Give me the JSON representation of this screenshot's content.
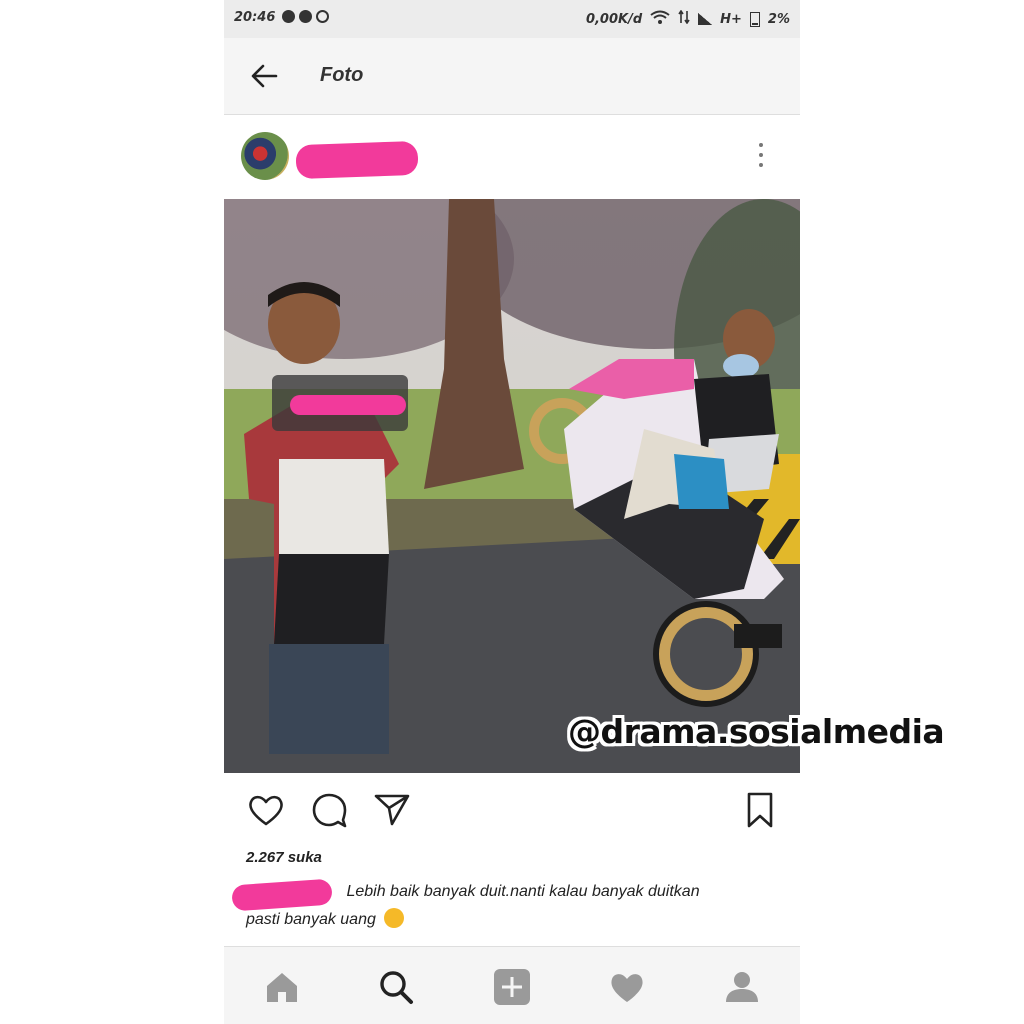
{
  "status_bar": {
    "time": "20:46",
    "speed": "0,00K/d",
    "network": "H+",
    "battery": "2%"
  },
  "header": {
    "title": "Foto"
  },
  "post": {
    "likes": "2.267 suka",
    "caption_line1": "Lebih baik banyak duit.nanti kalau banyak duitkan",
    "caption_line2": "pasti banyak uang"
  },
  "watermark": "@drama.sosialmedia",
  "colors": {
    "redaction": "#f23a9b",
    "status_bar_bg": "#ececec",
    "header_bg": "#f5f5f5"
  },
  "icons": {
    "back": "arrow-left-icon",
    "more": "more-vertical-icon",
    "like": "heart-icon",
    "comment": "comment-icon",
    "share": "send-icon",
    "save": "bookmark-icon",
    "nav": [
      "home-icon",
      "search-icon",
      "add-icon",
      "activity-heart-icon",
      "profile-icon"
    ]
  }
}
